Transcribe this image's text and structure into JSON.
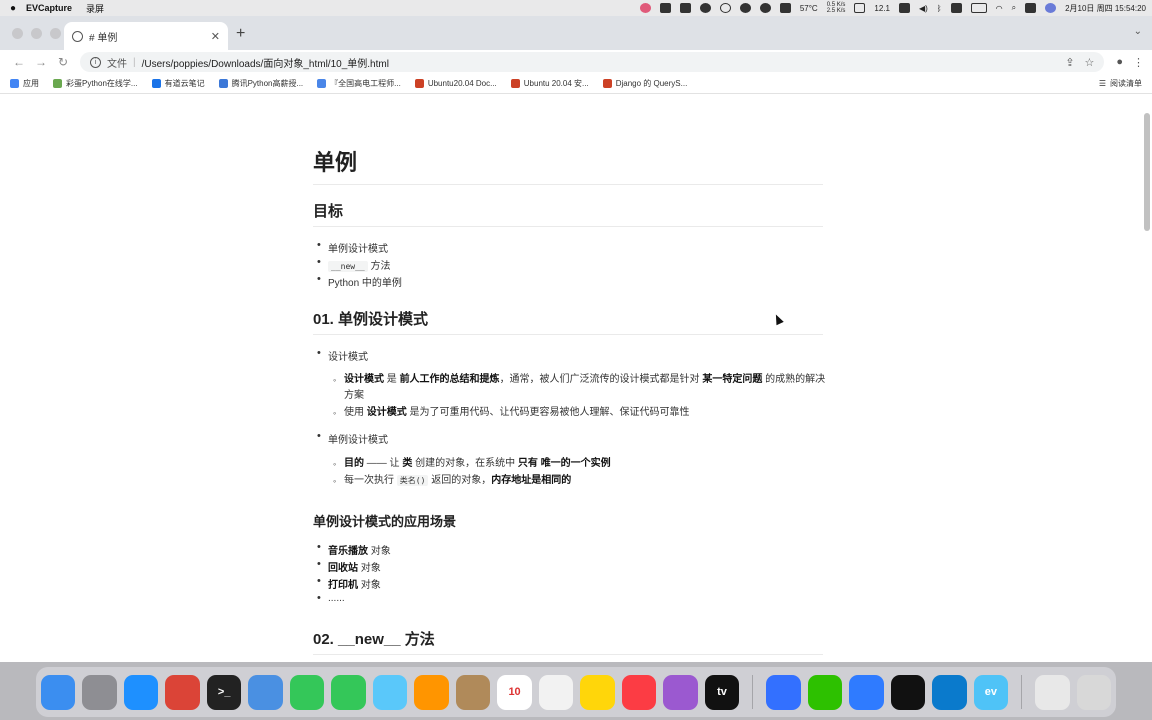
{
  "menubar": {
    "app_name": "EVCapture",
    "menu_item": "录屏",
    "temp": "57°C",
    "net": "0.5 K/s\n2.5 K/s",
    "battery": "12.1",
    "datetime": "2月10日 周四 15:54:20"
  },
  "browser": {
    "tab_title": "# 单例",
    "address_scheme": "文件",
    "address_path": "/Users/poppies/Downloads/面向对象_html/10_单例.html",
    "bookmarks": [
      {
        "label": "应用",
        "color": "#4285f4"
      },
      {
        "label": "彩蛋Python在线学...",
        "color": "#6aa84f"
      },
      {
        "label": "有道云笔记",
        "color": "#1a73e8"
      },
      {
        "label": "腾讯Python高薪授...",
        "color": "#3c78d8"
      },
      {
        "label": "『全国高电工程师...",
        "color": "#4a86e8"
      },
      {
        "label": "Ubuntu20.04 Doc...",
        "color": "#cc4125"
      },
      {
        "label": "Ubuntu 20.04 安...",
        "color": "#cc4125"
      },
      {
        "label": "Django 的 QueryS...",
        "color": "#cc4125"
      }
    ],
    "reading_list": "阅读清单"
  },
  "article": {
    "h1": "单例",
    "goal_heading": "目标",
    "goals": [
      "单例设计模式",
      "__new__ 方法",
      "Python 中的单例"
    ],
    "goal2_code": "__new__",
    "goal2_rest": "方法",
    "sec1_heading": "01. 单例设计模式",
    "li_design": "设计模式",
    "sub1_b1": "设计模式",
    "sub1_t1": " 是 ",
    "sub1_b2": "前人工作的总结和提炼",
    "sub1_t2": "，通常，被人们广泛流传的设计模式都是针对 ",
    "sub1_b3": "某一特定问题",
    "sub1_t3": " 的成熟的解决方案",
    "sub2_t1": "使用 ",
    "sub2_b1": "设计模式",
    "sub2_t2": " 是为了可重用代码、让代码更容易被他人理解、保证代码可靠性",
    "li_singleton": "单例设计模式",
    "sub3_b1": "目的",
    "sub3_t1": " —— 让 ",
    "sub3_b2": "类",
    "sub3_t2": " 创建的对象，在系统中 ",
    "sub3_b3": "只有",
    "sub3_t3": " ",
    "sub3_b4": "唯一的一个实例",
    "sub4_t1": "每一次执行 ",
    "sub4_code": "类名()",
    "sub4_t2": " 返回的对象，",
    "sub4_b1": "内存地址是相同的",
    "scene_heading": "单例设计模式的应用场景",
    "scenes": [
      {
        "bold": "音乐播放",
        "rest": " 对象"
      },
      {
        "bold": "回收站",
        "rest": " 对象"
      },
      {
        "bold": "打印机",
        "rest": " 对象"
      }
    ],
    "ellipsis": "......",
    "sec2_heading": "02. __new__ 方法"
  },
  "dock": {
    "apps": [
      {
        "name": "finder-icon",
        "color": "#3b8ef0",
        "label": ""
      },
      {
        "name": "launchpad-icon",
        "color": "#8e8e93",
        "label": ""
      },
      {
        "name": "safari-icon",
        "color": "#1e90ff",
        "label": ""
      },
      {
        "name": "chrome-icon",
        "color": "#db4437",
        "label": ""
      },
      {
        "name": "terminal-icon",
        "color": "#222222",
        "label": ">_"
      },
      {
        "name": "mail-icon",
        "color": "#4a90e2",
        "label": ""
      },
      {
        "name": "facetime-icon",
        "color": "#34c759",
        "label": ""
      },
      {
        "name": "messages-icon",
        "color": "#34c759",
        "label": ""
      },
      {
        "name": "maps-icon",
        "color": "#5ac8fa",
        "label": ""
      },
      {
        "name": "photos-icon",
        "color": "#ff9500",
        "label": ""
      },
      {
        "name": "contacts-icon",
        "color": "#b08a5a",
        "label": ""
      },
      {
        "name": "calendar-icon",
        "color": "#ffffff",
        "label": "10"
      },
      {
        "name": "reminders-icon",
        "color": "#f2f2f2",
        "label": ""
      },
      {
        "name": "notes-icon",
        "color": "#ffd60a",
        "label": ""
      },
      {
        "name": "music-icon",
        "color": "#fc3c44",
        "label": ""
      },
      {
        "name": "podcasts-icon",
        "color": "#9b59d0",
        "label": ""
      },
      {
        "name": "appletv-icon",
        "color": "#111111",
        "label": "tv"
      },
      {
        "name": "feishu-icon",
        "color": "#3370ff",
        "label": ""
      },
      {
        "name": "wechat-icon",
        "color": "#2dc100",
        "label": ""
      },
      {
        "name": "baidunetdisk-icon",
        "color": "#2f7bff",
        "label": ""
      },
      {
        "name": "qq-icon",
        "color": "#111111",
        "label": ""
      },
      {
        "name": "vscode-icon",
        "color": "#0a7acc",
        "label": ""
      },
      {
        "name": "evcapture-icon",
        "color": "#4fc3f7",
        "label": "ev"
      },
      {
        "name": "preview-icon",
        "color": "#e8e8e8",
        "label": ""
      },
      {
        "name": "trash-icon",
        "color": "#d8d8d8",
        "label": ""
      }
    ]
  }
}
